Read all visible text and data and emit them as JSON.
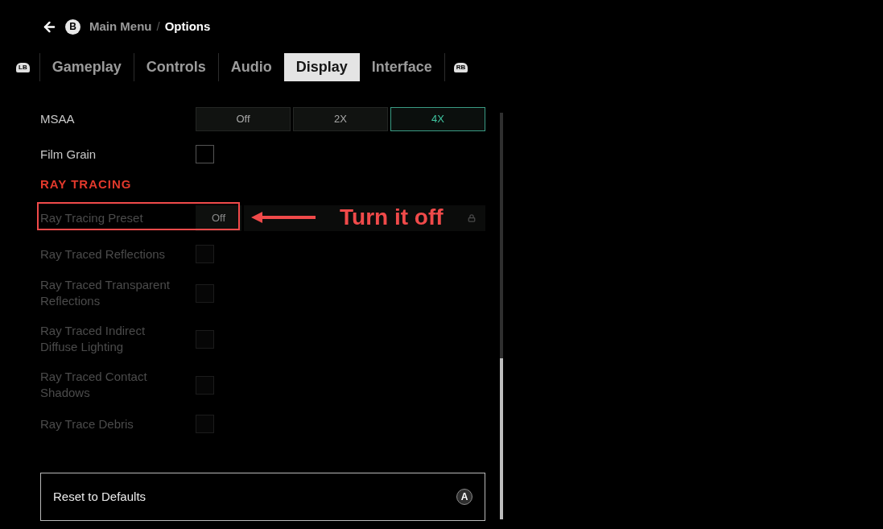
{
  "breadcrumb": {
    "back_key": "B",
    "separator": "/",
    "items": [
      {
        "label": "Main Menu",
        "current": false
      },
      {
        "label": "Options",
        "current": true
      }
    ]
  },
  "tabs": {
    "prev_key": "LB",
    "next_key": "RB",
    "items": [
      {
        "label": "Gameplay",
        "selected": false
      },
      {
        "label": "Controls",
        "selected": false
      },
      {
        "label": "Audio",
        "selected": false
      },
      {
        "label": "Display",
        "selected": true
      },
      {
        "label": "Interface",
        "selected": false
      }
    ]
  },
  "settings": [
    {
      "kind": "segmented",
      "label": "MSAA",
      "disabled": false,
      "options": [
        {
          "label": "Off",
          "selected": false
        },
        {
          "label": "2X",
          "selected": false
        },
        {
          "label": "4X",
          "selected": true
        }
      ]
    },
    {
      "kind": "checkbox",
      "label": "Film Grain",
      "disabled": false,
      "checked": false
    },
    {
      "kind": "header",
      "label": "RAY TRACING"
    },
    {
      "kind": "select",
      "label": "Ray Tracing Preset",
      "disabled": true,
      "value": "Off",
      "locked": true,
      "annotation": {
        "text": "Turn it off"
      }
    },
    {
      "kind": "checkbox",
      "label": "Ray Traced Reflections",
      "disabled": true,
      "checked": false
    },
    {
      "kind": "checkbox",
      "label": "Ray Traced Transparent Reflections",
      "disabled": true,
      "checked": false
    },
    {
      "kind": "checkbox",
      "label": "Ray Traced Indirect Diffuse Lighting",
      "disabled": true,
      "checked": false
    },
    {
      "kind": "checkbox",
      "label": "Ray Traced Contact Shadows",
      "disabled": true,
      "checked": false
    },
    {
      "kind": "checkbox",
      "label": "Ray Trace Debris",
      "disabled": true,
      "checked": false
    }
  ],
  "reset_button": {
    "label": "Reset to Defaults",
    "key": "A"
  }
}
